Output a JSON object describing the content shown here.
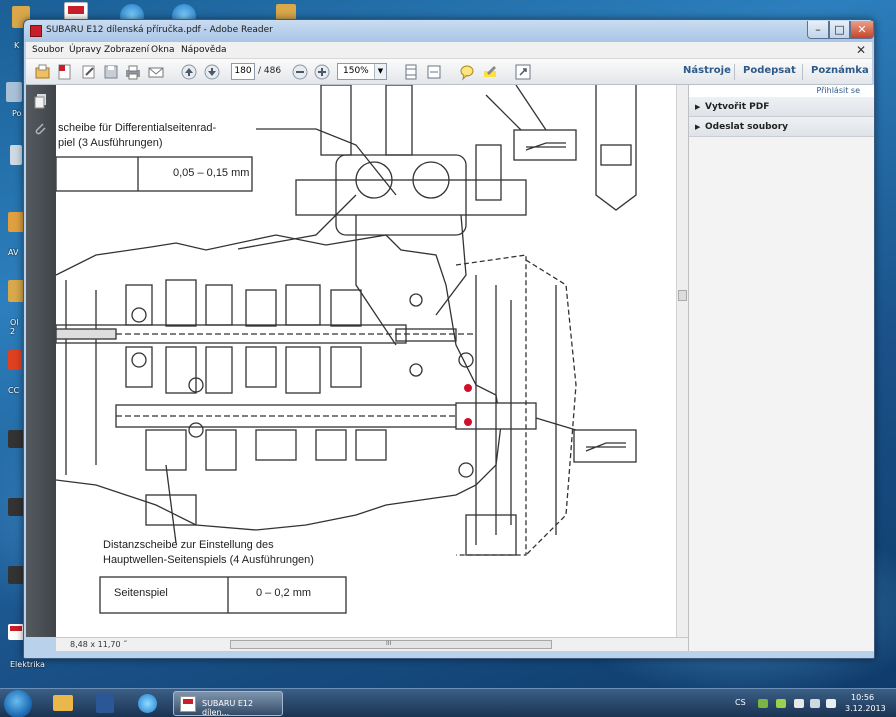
{
  "window": {
    "title": "SUBARU E12 dílenská příručka.pdf - Adobe Reader",
    "min_glyph": "–",
    "max_glyph": "□",
    "close_glyph": "✕"
  },
  "menu": [
    "Soubor",
    "Úpravy",
    "Zobrazení",
    "Okna",
    "Nápověda"
  ],
  "menu_close_glyph": "✕",
  "toolbar": {
    "page_current": "180",
    "page_total": "/ 486",
    "zoom": "150%",
    "links": [
      "Nástroje",
      "Podepsat",
      "Poznámka"
    ]
  },
  "right_pane": {
    "sign_in": "Přihlásit se",
    "items": [
      "Vytvořit PDF",
      "Odeslat soubory"
    ]
  },
  "status": {
    "page_size": "8,48 x 11,70 ˝",
    "scroll_grip": "III"
  },
  "drawing": {
    "label_top_line1": "scheibe für Differentialseitenrad-",
    "label_top_line2": "piel (3 Ausführungen)",
    "top_table_value": "0,05 – 0,15 mm",
    "label_bottom_line1": "Distanzscheibe zur Einstellung des",
    "label_bottom_line2": "Hauptwellen-Seitenspiels (4 Ausführungen)",
    "bottom_table_label": "Seitenspiel",
    "bottom_table_value": "0 – 0,2 mm"
  },
  "desktop_labels": [
    "K",
    "Po",
    "AV",
    "Ol 2",
    "CC",
    "Elektrika"
  ],
  "taskbar": {
    "active_task": "SUBARU E12 dílen...",
    "lang": "CS",
    "time": "10:56",
    "date": "3.12.2013"
  },
  "colors": {
    "accent_link": "#2e5a8a",
    "window_frame": "#b9d1ea",
    "close_button": "#c8442a",
    "highlight_red": "#d0102a"
  }
}
